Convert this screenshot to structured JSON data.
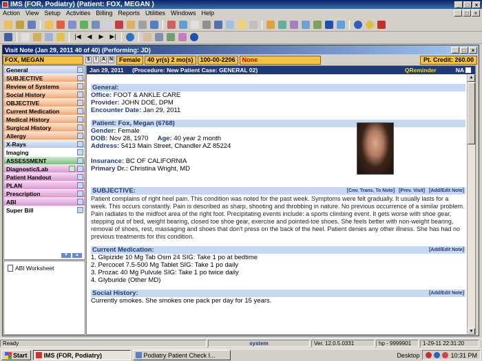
{
  "app": {
    "title": "IMS (FOR, Podiatry)    (Patient: FOX, MEGAN )"
  },
  "menu": [
    "Action",
    "View",
    "Setup",
    "Activities",
    "Billing",
    "Reports",
    "Utilities",
    "Windows",
    "Help"
  ],
  "visit_window": {
    "title": "Visit Note (Jan 29, 2011    40 of 40) (Performing: JD)"
  },
  "patient_strip": {
    "name": "FOX, MEGAN",
    "gender": "Female",
    "age": "40 yr(s) 2 mo(s)",
    "phone": "100-00-2206",
    "flag": "None",
    "credit": "Pt. Credit:  260.00"
  },
  "nav": {
    "items": [
      {
        "label": "General",
        "color": "blue"
      },
      {
        "label": "SUBJECTIVE",
        "color": "orange"
      },
      {
        "label": "Review of Systems",
        "color": "orange"
      },
      {
        "label": "Social History",
        "color": "orange"
      },
      {
        "label": "OBJECTIVE",
        "color": "orange"
      },
      {
        "label": "Current Medication",
        "color": "orange"
      },
      {
        "label": "Medical History",
        "color": "orange"
      },
      {
        "label": "Surgical History",
        "color": "orange"
      },
      {
        "label": "Allergy",
        "color": "orange"
      },
      {
        "label": "X-Rays",
        "color": "blue"
      },
      {
        "label": "Imaging",
        "color": "white"
      },
      {
        "label": "ASSESSMENT",
        "color": "green"
      },
      {
        "label": "Diagnostic/Lab",
        "color": "pink"
      },
      {
        "label": "Patient Handout",
        "color": "pink"
      },
      {
        "label": "PLAN",
        "color": "pink"
      },
      {
        "label": "Prescription",
        "color": "pink"
      },
      {
        "label": "ABI",
        "color": "pink"
      },
      {
        "label": "Super Bill",
        "color": "white"
      }
    ],
    "worksheet": "ABI Worksheet"
  },
  "note_header": {
    "date": "Jan 29, 2011",
    "procedure": "(Procedure:  New Patient  Case: GENERAL 02)",
    "qreminder": "QReminder",
    "na": "NA"
  },
  "general": {
    "heading": "General:",
    "office_label": "Office:",
    "office": "FOOT & ANKLE CARE",
    "provider_label": "Provider:",
    "provider": "JOHN  DOE, DPM",
    "encounter_label": "Encounter Date:",
    "encounter": "Jan 29, 2011"
  },
  "patient": {
    "heading": "Patient: Fox, Megan     (6768)",
    "gender_label": "Gender:",
    "gender": "Female",
    "dob_label": "DOB:",
    "dob": "Nov 28, 1970",
    "age_label": "Age:",
    "age": "40 year 2 month",
    "address_label": "Address:",
    "address": "5413 Main Street,  Chandler  AZ  85224",
    "insurance_label": "Insurance:",
    "insurance": "BC OF CALIFORNIA",
    "pcp_label": "Primary Dr.:",
    "pcp": "Christina Wright, MD"
  },
  "subjective": {
    "heading": "SUBJECTIVE:",
    "links": [
      "[Cnv. Trans. To Note]",
      "[Prev. Visit]",
      "[Add/Edit Note]"
    ],
    "text": "Patient complains of right heel pain. This condition was noted for the past week. Symptoms were felt gradually. It usually lasts for a week. This occurs constantly. Pain is described as sharp, shooting and throbbing in nature. No previous occurrence of a similar problem. Pain radiates to the midfoot area of the right foot. Precipitating events include: a sports climbing event. It gets worse with shoe gear, stepping out of bed, weight bearing, closed toe shoe gear, exercise and pointed-toe shoes. She feels better with non-weight bearing, removal of shoes, rest, massaging and shoes that don't press on the back of the heel. Patient denies any other illness. She has had no previous treatments for this condition."
  },
  "medication": {
    "heading": "Current Medication:",
    "link": "[Add/Edit Note]",
    "items": [
      "1. Glipizide 10 Mg Tab Osm 24  SIG: Take 1 po at bedtime",
      "2. Percocet 7.5-500 Mg Tablet  SIG: Take 1 po daily",
      "3. Prozac 40 Mg Pulvule  SIG: Take 1 po twice daily",
      "4. Glyburide (Other MD)"
    ]
  },
  "social": {
    "heading": "Social History:",
    "link": "[Add/Edit Note]",
    "text": "Currently smokes. She smokes one pack per day for 15 years."
  },
  "status": {
    "ready": "Ready",
    "system": "system",
    "version": "Ver. 12.0.5.0331",
    "hp": "hp - 9999901",
    "datetime": "1-29-11 22:31:20"
  },
  "taskbar": {
    "start": "Start",
    "tasks": [
      "IMS (FOR, Podiatry)",
      "Podiatry Patient Check I..."
    ],
    "desktop": "Desktop",
    "clock": "10:31 PM"
  }
}
